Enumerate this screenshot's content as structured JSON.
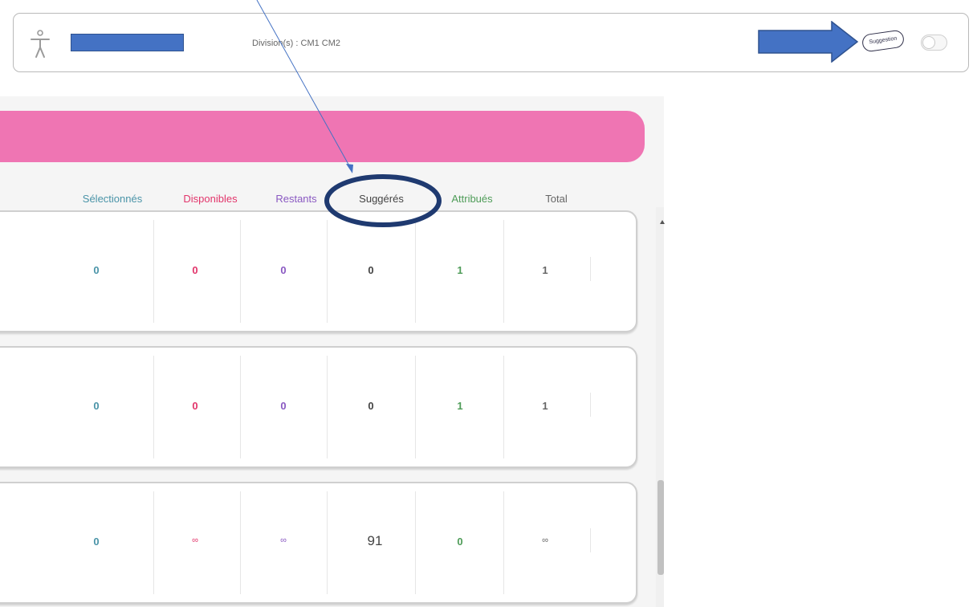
{
  "header": {
    "division_text": "Division(s) : CM1 CM2",
    "suggestion_label": "Suggestion",
    "suggestion_toggle_on": false
  },
  "table": {
    "columns": [
      "Sélectionnés",
      "Disponibles",
      "Restants",
      "Suggérés",
      "Attribués",
      "Total"
    ],
    "colors": {
      "selectionnes": "#4a94a8",
      "disponibles": "#e2356b",
      "restants": "#8a59c2",
      "suggeres": "#444444",
      "attribues": "#4e9c58",
      "total": "#666666"
    },
    "rows": [
      [
        "0",
        "0",
        "0",
        "0",
        "1",
        "1"
      ],
      [
        "0",
        "0",
        "0",
        "0",
        "1",
        "1"
      ],
      [
        "0",
        "∞",
        "∞",
        "91",
        "0",
        "∞"
      ]
    ]
  },
  "colors": {
    "pink_bar": "#ef75b3",
    "annotation_blue": "#4472c4",
    "circle_navy": "#1f3a70"
  },
  "icons": [
    "accessibility-icon",
    "arrow-right-icon"
  ]
}
